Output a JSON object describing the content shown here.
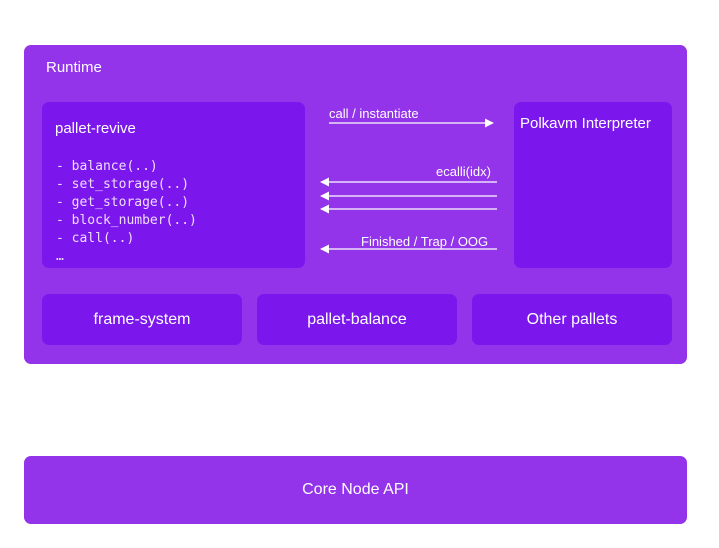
{
  "runtime": {
    "label": "Runtime"
  },
  "pallet_revive": {
    "title": "pallet-revive",
    "functions": [
      "- balance(..)",
      "- set_storage(..)",
      "- get_storage(..)",
      "- block_number(..)",
      "- call(..)",
      "…"
    ]
  },
  "interpreter": {
    "title": "Polkavm Interpreter"
  },
  "arrows": {
    "call": "call / instantiate",
    "ecalli": "ecalli(idx)",
    "finished": "Finished / Trap / OOG"
  },
  "pallets": [
    "frame-system",
    "pallet-balance",
    "Other pallets"
  ],
  "core": {
    "label": "Core Node API"
  },
  "colors": {
    "outer": "#9333ea",
    "inner": "#7b17ec",
    "text": "#ffffff"
  }
}
